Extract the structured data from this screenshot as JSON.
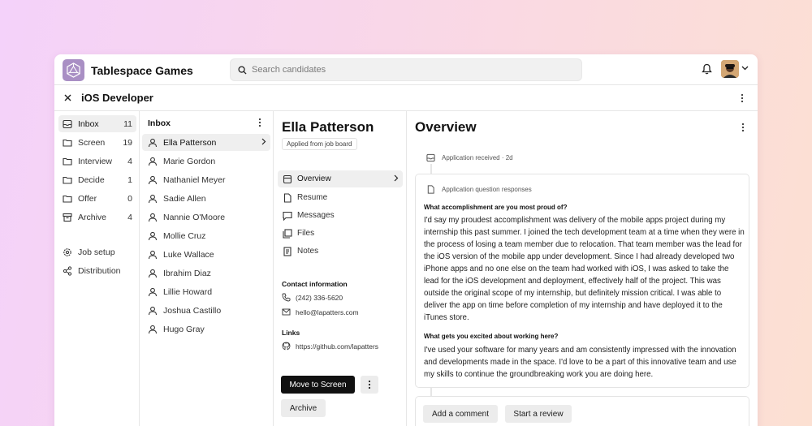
{
  "app": {
    "name": "Tablespace Games"
  },
  "search": {
    "placeholder": "Search candidates"
  },
  "job": {
    "title": "iOS Developer"
  },
  "stages": [
    {
      "label": "Inbox",
      "count": "11",
      "icon": "inbox-icon"
    },
    {
      "label": "Screen",
      "count": "19",
      "icon": "folder-icon"
    },
    {
      "label": "Interview",
      "count": "4",
      "icon": "folder-icon"
    },
    {
      "label": "Decide",
      "count": "1",
      "icon": "folder-icon"
    },
    {
      "label": "Offer",
      "count": "0",
      "icon": "folder-icon"
    },
    {
      "label": "Archive",
      "count": "4",
      "icon": "archive-icon"
    }
  ],
  "settings": [
    {
      "label": "Job setup",
      "icon": "gear-icon"
    },
    {
      "label": "Distribution",
      "icon": "share-icon"
    }
  ],
  "inbox": {
    "title": "Inbox",
    "candidates": [
      "Ella Patterson",
      "Marie Gordon",
      "Nathaniel Meyer",
      "Sadie Allen",
      "Nannie O'Moore",
      "Mollie Cruz",
      "Luke Wallace",
      "Ibrahim Diaz",
      "Lillie Howard",
      "Joshua Castillo",
      "Hugo Gray"
    ]
  },
  "candidate": {
    "name": "Ella Patterson",
    "source": "Applied from job board",
    "nav": [
      {
        "label": "Overview",
        "icon": "square-icon"
      },
      {
        "label": "Resume",
        "icon": "document-icon"
      },
      {
        "label": "Messages",
        "icon": "message-icon"
      },
      {
        "label": "Files",
        "icon": "files-icon"
      },
      {
        "label": "Notes",
        "icon": "notes-icon"
      }
    ],
    "contact_heading": "Contact information",
    "phone": "(242) 336-5620",
    "email": "hello@lapatters.com",
    "links_heading": "Links",
    "link": "https://github.com/lapatters",
    "primary_action": "Move to Screen",
    "secondary_action": "Archive"
  },
  "overview": {
    "title": "Overview",
    "event": "Application received · 2d",
    "responses_heading": "Application question responses",
    "q1": "What accomplishment are you most proud of?",
    "a1": "I'd say my proudest accomplishment was delivery of the mobile apps project during my internship this past summer. I joined the tech development team at a time when they were in the process of losing a team member due to relocation. That team member was the lead for the iOS version of the mobile app under development. Since I had already developed two iPhone apps and no one else on the team had worked with iOS, I was asked to take the lead for the iOS development and deployment, effectively half of the project. This was outside the original scope of my internship, but definitely mission critical. I was able to deliver the app on time before completion of my internship and have deployed it to the iTunes store.",
    "q2": "What gets you excited about working here?",
    "a2": "I've used your software for many years and am consistently impressed with the innovation and developments made in the space. I'd love to be a part of this innovative team and use my skills to continue the groundbreaking work you are doing here.",
    "comment_button": "Add a comment",
    "review_button": "Start a review"
  }
}
